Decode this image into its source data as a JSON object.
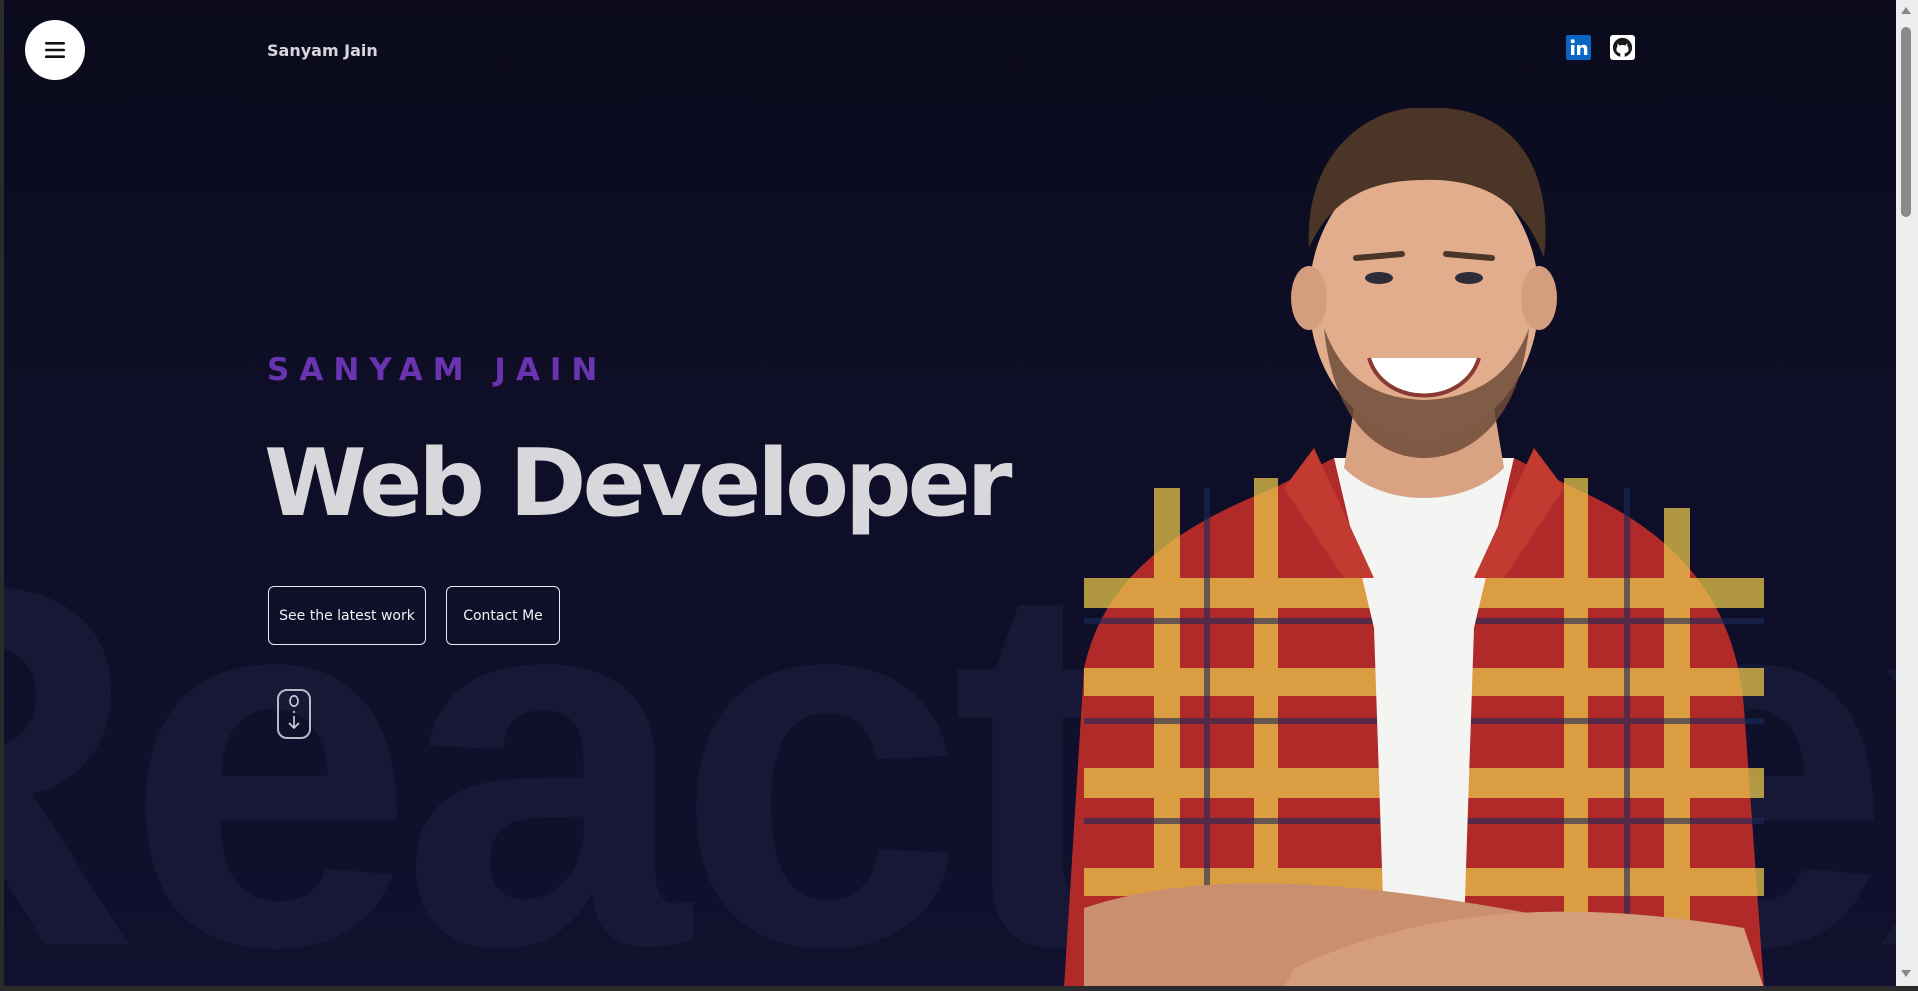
{
  "header": {
    "brand": "Sanyam Jain",
    "menu_icon": "hamburger-icon",
    "social": [
      {
        "name": "LinkedIn",
        "icon": "linkedin-icon",
        "color": "#0a66c2"
      },
      {
        "name": "GitHub",
        "icon": "github-icon",
        "color": "#ffffff"
      }
    ]
  },
  "hero": {
    "eyebrow": "SANYAM JAIN",
    "headline": "Web Developer",
    "background_text": "React NextJS",
    "buttons": {
      "work": "See the latest work",
      "contact": "Contact Me"
    },
    "scroll_icon": "mouse-scroll-icon",
    "accent_color": "#6a33b0"
  }
}
